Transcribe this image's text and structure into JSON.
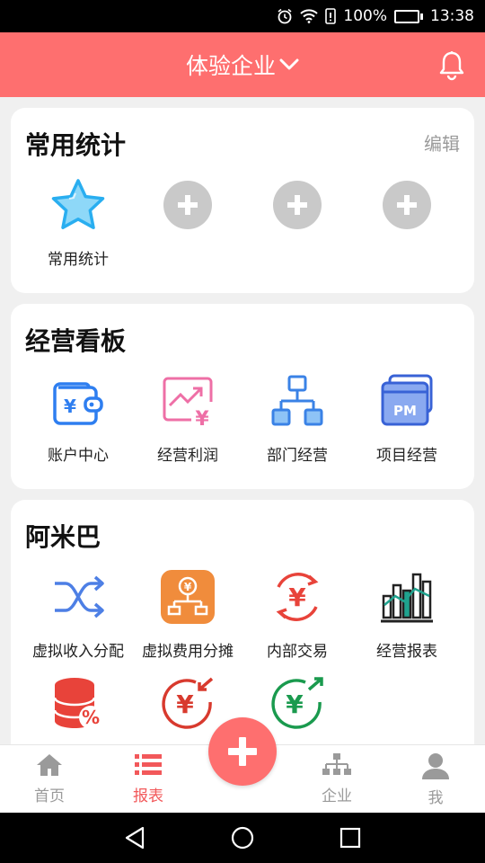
{
  "status_bar": {
    "battery": "100%",
    "time": "13:38"
  },
  "header": {
    "title": "体验企业",
    "accent": "#fe6f6f"
  },
  "cards": {
    "common": {
      "title": "常用统计",
      "edit": "编辑",
      "items": [
        {
          "label": "常用统计",
          "icon": "star-icon"
        }
      ],
      "add_slots": 3
    },
    "dashboard": {
      "title": "经营看板",
      "items": [
        {
          "label": "账户中心",
          "icon": "wallet-icon"
        },
        {
          "label": "经营利润",
          "icon": "profit-chart-icon"
        },
        {
          "label": "部门经营",
          "icon": "org-chart-icon"
        },
        {
          "label": "项目经营",
          "icon": "pm-window-icon"
        }
      ]
    },
    "amoeba": {
      "title": "阿米巴",
      "items": [
        {
          "label": "虚拟收入分配",
          "icon": "shuffle-icon"
        },
        {
          "label": "虚拟费用分摊",
          "icon": "cost-split-icon"
        },
        {
          "label": "内部交易",
          "icon": "yuan-exchange-icon"
        },
        {
          "label": "经营报表",
          "icon": "bar-report-icon"
        },
        {
          "label": "",
          "icon": "database-percent-icon"
        },
        {
          "label": "",
          "icon": "yuan-in-icon"
        },
        {
          "label": "",
          "icon": "yuan-out-icon"
        }
      ]
    }
  },
  "tabbar": {
    "items": [
      {
        "label": "首页",
        "icon": "home-icon",
        "active": false
      },
      {
        "label": "报表",
        "icon": "list-icon",
        "active": true
      },
      {
        "label": "企业",
        "icon": "org-icon",
        "active": false
      },
      {
        "label": "我",
        "icon": "user-icon",
        "active": false
      }
    ],
    "fab_icon": "plus-icon"
  }
}
